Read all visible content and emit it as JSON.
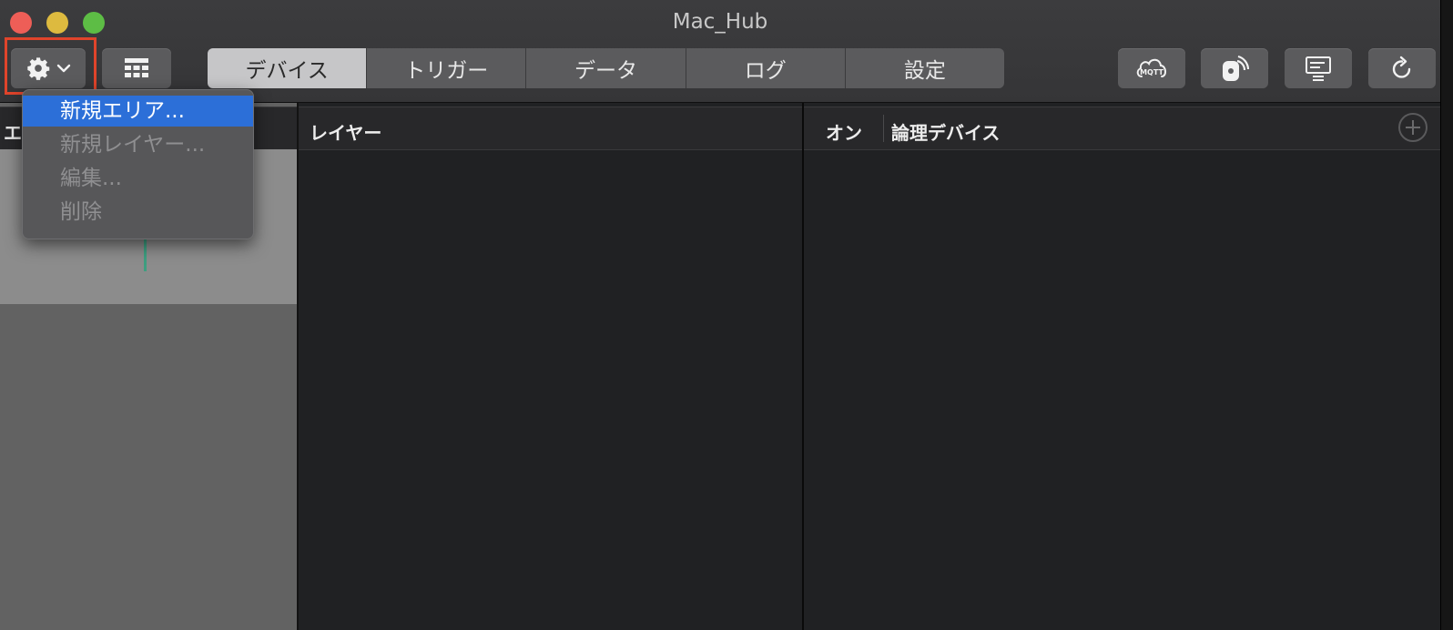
{
  "window": {
    "title": "Mac_Hub"
  },
  "toolbar": {
    "settings_icon": "gear-icon",
    "layout_icon": "grid-layout-icon",
    "tabs": [
      {
        "label": "デバイス",
        "active": true
      },
      {
        "label": "トリガー",
        "active": false
      },
      {
        "label": "データ",
        "active": false
      },
      {
        "label": "ログ",
        "active": false
      },
      {
        "label": "設定",
        "active": false
      }
    ],
    "right_buttons": [
      {
        "icon": "mqtt-cloud-icon",
        "text": "MQTT"
      },
      {
        "icon": "wireless-device-icon"
      },
      {
        "icon": "display-panel-icon"
      },
      {
        "icon": "refresh-icon"
      }
    ]
  },
  "dropdown_menu": {
    "items": [
      {
        "label": "新規エリア...",
        "enabled": true,
        "selected": true
      },
      {
        "label": "新規レイヤー...",
        "enabled": false,
        "selected": false
      },
      {
        "label": "編集...",
        "enabled": false,
        "selected": false
      },
      {
        "label": "削除",
        "enabled": false,
        "selected": false
      }
    ]
  },
  "panes": {
    "left": {
      "header": "エ"
    },
    "middle": {
      "header": "レイヤー"
    },
    "right": {
      "col_on": "オン",
      "col_logical": "論理デバイス",
      "add_icon": "plus-circle-icon"
    }
  },
  "colors": {
    "accent_selection": "#2c6fd8",
    "highlight_box": "#e0442b",
    "traffic_close": "#ee5e57",
    "traffic_minimize": "#ddba3f",
    "traffic_maximize": "#5dbd45"
  }
}
